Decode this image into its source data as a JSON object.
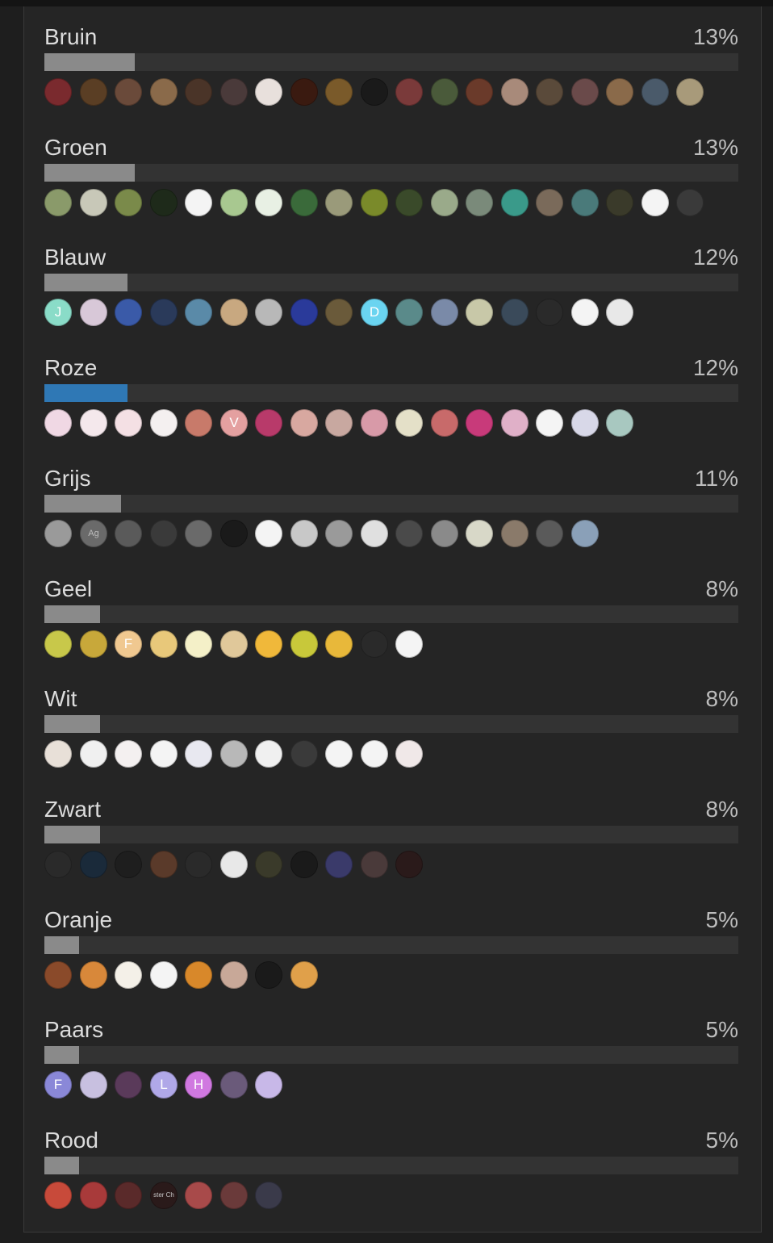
{
  "options": [
    {
      "label": "Bruin",
      "percent_text": "13%",
      "percent": 13,
      "voted": false,
      "voters": [
        {
          "color": "#7a2a2e",
          "text": ""
        },
        {
          "color": "#5a3e24",
          "text": ""
        },
        {
          "color": "#6a4a3a",
          "text": ""
        },
        {
          "color": "#8a6a4a",
          "text": ""
        },
        {
          "color": "#4a3428",
          "text": ""
        },
        {
          "color": "#4a3a3a",
          "text": ""
        },
        {
          "color": "#e8e0dc",
          "text": ""
        },
        {
          "color": "#3a1a10",
          "text": ""
        },
        {
          "color": "#7a5a2a",
          "text": ""
        },
        {
          "color": "#1a1a1a",
          "text": ""
        },
        {
          "color": "#7a3a3a",
          "text": ""
        },
        {
          "color": "#4a5a3a",
          "text": ""
        },
        {
          "color": "#6a3a2a",
          "text": ""
        },
        {
          "color": "#a88a7a",
          "text": ""
        },
        {
          "color": "#5a4a3a",
          "text": ""
        },
        {
          "color": "#6a4a4a",
          "text": ""
        },
        {
          "color": "#8a6a4a",
          "text": ""
        },
        {
          "color": "#4a5a6a",
          "text": ""
        },
        {
          "color": "#a89a7a",
          "text": ""
        }
      ]
    },
    {
      "label": "Groen",
      "percent_text": "13%",
      "percent": 13,
      "voted": false,
      "voters": [
        {
          "color": "#8a9a6a",
          "text": ""
        },
        {
          "color": "#c8c8b8",
          "text": ""
        },
        {
          "color": "#7a8a4a",
          "text": ""
        },
        {
          "color": "#1e2a1a",
          "text": ""
        },
        {
          "color": "#f4f4f4",
          "text": ""
        },
        {
          "color": "#a8c890",
          "text": ""
        },
        {
          "color": "#e8f0e4",
          "text": ""
        },
        {
          "color": "#3a6a3a",
          "text": ""
        },
        {
          "color": "#9a9a7a",
          "text": ""
        },
        {
          "color": "#7a8a2a",
          "text": ""
        },
        {
          "color": "#3a4a2a",
          "text": ""
        },
        {
          "color": "#9aaa8a",
          "text": ""
        },
        {
          "color": "#7a8a7a",
          "text": ""
        },
        {
          "color": "#3a9a8a",
          "text": ""
        },
        {
          "color": "#7a6a5a",
          "text": ""
        },
        {
          "color": "#4a7a7a",
          "text": ""
        },
        {
          "color": "#3a3a2a",
          "text": ""
        },
        {
          "color": "#f4f4f4",
          "text": ""
        },
        {
          "color": "#3a3a3a",
          "text": ""
        }
      ]
    },
    {
      "label": "Blauw",
      "percent_text": "12%",
      "percent": 12,
      "voted": false,
      "voters": [
        {
          "color": "#8adcc8",
          "text": "J"
        },
        {
          "color": "#d8c8d8",
          "text": ""
        },
        {
          "color": "#3a5aa8",
          "text": ""
        },
        {
          "color": "#2a3a5a",
          "text": ""
        },
        {
          "color": "#5a8aa8",
          "text": ""
        },
        {
          "color": "#c8a880",
          "text": ""
        },
        {
          "color": "#b8b8b8",
          "text": ""
        },
        {
          "color": "#2a3a9a",
          "text": ""
        },
        {
          "color": "#6a5a3a",
          "text": ""
        },
        {
          "color": "#6ad4f0",
          "text": "D"
        },
        {
          "color": "#5a8a8a",
          "text": ""
        },
        {
          "color": "#7a8aa8",
          "text": ""
        },
        {
          "color": "#c8c8a8",
          "text": ""
        },
        {
          "color": "#3a4a5a",
          "text": ""
        },
        {
          "color": "#2a2a2a",
          "text": ""
        },
        {
          "color": "#f4f4f4",
          "text": ""
        },
        {
          "color": "#e8e8e8",
          "text": ""
        }
      ]
    },
    {
      "label": "Roze",
      "percent_text": "12%",
      "percent": 12,
      "voted": true,
      "voters": [
        {
          "color": "#f0d8e4",
          "text": ""
        },
        {
          "color": "#f4e8ec",
          "text": ""
        },
        {
          "color": "#f4e0e4",
          "text": ""
        },
        {
          "color": "#f4f0f0",
          "text": ""
        },
        {
          "color": "#c87a6a",
          "text": ""
        },
        {
          "color": "#e4a0a0",
          "text": "V"
        },
        {
          "color": "#b83a6a",
          "text": ""
        },
        {
          "color": "#d8a8a0",
          "text": ""
        },
        {
          "color": "#c8a8a0",
          "text": ""
        },
        {
          "color": "#d89aa8",
          "text": ""
        },
        {
          "color": "#e4e0c8",
          "text": ""
        },
        {
          "color": "#c86a6a",
          "text": ""
        },
        {
          "color": "#c83a7a",
          "text": ""
        },
        {
          "color": "#e0b0c8",
          "text": ""
        },
        {
          "color": "#f4f4f4",
          "text": ""
        },
        {
          "color": "#d8d8e8",
          "text": ""
        },
        {
          "color": "#a8c8c0",
          "text": ""
        }
      ]
    },
    {
      "label": "Grijs",
      "percent_text": "11%",
      "percent": 11,
      "voted": false,
      "voters": [
        {
          "color": "#9a9a9a",
          "text": ""
        },
        {
          "color": "#6a6a6a",
          "text": "Ag"
        },
        {
          "color": "#5a5a5a",
          "text": ""
        },
        {
          "color": "#3a3a3a",
          "text": ""
        },
        {
          "color": "#6a6a6a",
          "text": ""
        },
        {
          "color": "#1a1a1a",
          "text": ""
        },
        {
          "color": "#f4f4f4",
          "text": ""
        },
        {
          "color": "#c8c8c8",
          "text": ""
        },
        {
          "color": "#9a9a9a",
          "text": ""
        },
        {
          "color": "#e0e0e0",
          "text": ""
        },
        {
          "color": "#4a4a4a",
          "text": ""
        },
        {
          "color": "#8a8a8a",
          "text": ""
        },
        {
          "color": "#d8d8c8",
          "text": ""
        },
        {
          "color": "#8a7a6a",
          "text": ""
        },
        {
          "color": "#5a5a5a",
          "text": ""
        },
        {
          "color": "#8aa0b8",
          "text": ""
        }
      ]
    },
    {
      "label": "Geel",
      "percent_text": "8%",
      "percent": 8,
      "voted": false,
      "voters": [
        {
          "color": "#c8c84a",
          "text": ""
        },
        {
          "color": "#c8a83a",
          "text": ""
        },
        {
          "color": "#f0c890",
          "text": "F"
        },
        {
          "color": "#e8c87a",
          "text": ""
        },
        {
          "color": "#f4f0c8",
          "text": ""
        },
        {
          "color": "#e0c89a",
          "text": ""
        },
        {
          "color": "#f0b83a",
          "text": ""
        },
        {
          "color": "#c8c83a",
          "text": ""
        },
        {
          "color": "#e8b83a",
          "text": ""
        },
        {
          "color": "#2a2a2a",
          "text": ""
        },
        {
          "color": "#f4f4f4",
          "text": ""
        }
      ]
    },
    {
      "label": "Wit",
      "percent_text": "8%",
      "percent": 8,
      "voted": false,
      "voters": [
        {
          "color": "#e8e0d8",
          "text": ""
        },
        {
          "color": "#f0f0f0",
          "text": ""
        },
        {
          "color": "#f4f0f0",
          "text": ""
        },
        {
          "color": "#f4f4f4",
          "text": ""
        },
        {
          "color": "#e8e8f0",
          "text": ""
        },
        {
          "color": "#b8b8b8",
          "text": ""
        },
        {
          "color": "#f0f0f0",
          "text": ""
        },
        {
          "color": "#3a3a3a",
          "text": ""
        },
        {
          "color": "#f4f4f4",
          "text": ""
        },
        {
          "color": "#f4f4f4",
          "text": ""
        },
        {
          "color": "#f0e8e8",
          "text": ""
        }
      ]
    },
    {
      "label": "Zwart",
      "percent_text": "8%",
      "percent": 8,
      "voted": false,
      "voters": [
        {
          "color": "#2a2a2a",
          "text": ""
        },
        {
          "color": "#1a2a3a",
          "text": ""
        },
        {
          "color": "#1e1e1e",
          "text": ""
        },
        {
          "color": "#5a3a2a",
          "text": ""
        },
        {
          "color": "#2a2a2a",
          "text": ""
        },
        {
          "color": "#e8e8e8",
          "text": ""
        },
        {
          "color": "#3a3a2a",
          "text": ""
        },
        {
          "color": "#1a1a1a",
          "text": ""
        },
        {
          "color": "#3a3a6a",
          "text": ""
        },
        {
          "color": "#4a3a3a",
          "text": ""
        },
        {
          "color": "#2a1a1a",
          "text": ""
        }
      ]
    },
    {
      "label": "Oranje",
      "percent_text": "5%",
      "percent": 5,
      "voted": false,
      "voters": [
        {
          "color": "#8a4a2a",
          "text": ""
        },
        {
          "color": "#d8883a",
          "text": ""
        },
        {
          "color": "#f4f0e8",
          "text": ""
        },
        {
          "color": "#f4f4f4",
          "text": ""
        },
        {
          "color": "#d8882a",
          "text": ""
        },
        {
          "color": "#c8a898",
          "text": ""
        },
        {
          "color": "#1a1a1a",
          "text": ""
        },
        {
          "color": "#e0a04a",
          "text": ""
        }
      ]
    },
    {
      "label": "Paars",
      "percent_text": "5%",
      "percent": 5,
      "voted": false,
      "voters": [
        {
          "color": "#8a88d8",
          "text": "F"
        },
        {
          "color": "#c8c0e0",
          "text": ""
        },
        {
          "color": "#5a3a5a",
          "text": ""
        },
        {
          "color": "#b0a8e8",
          "text": "L"
        },
        {
          "color": "#d078e0",
          "text": "H"
        },
        {
          "color": "#6a5a7a",
          "text": ""
        },
        {
          "color": "#c8b8e8",
          "text": ""
        }
      ]
    },
    {
      "label": "Rood",
      "percent_text": "5%",
      "percent": 5,
      "voted": false,
      "voters": [
        {
          "color": "#c84a3a",
          "text": ""
        },
        {
          "color": "#a83a3a",
          "text": ""
        },
        {
          "color": "#5a2a2a",
          "text": ""
        },
        {
          "color": "#2a1a1a",
          "text": "ster Ch"
        },
        {
          "color": "#a84a4a",
          "text": ""
        },
        {
          "color": "#6a3a3a",
          "text": ""
        },
        {
          "color": "#3a3a4a",
          "text": ""
        }
      ]
    }
  ]
}
